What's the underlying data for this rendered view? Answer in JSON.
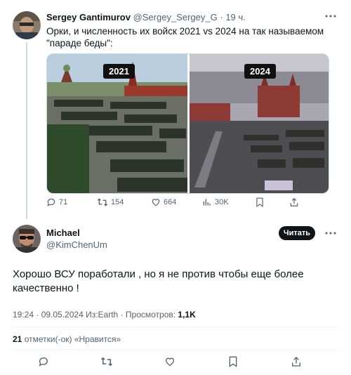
{
  "parent_tweet": {
    "author_name": "Sergey Gantimurov",
    "handle": "@Sergey_Sergey_G",
    "separator": "·",
    "time": "19 ч.",
    "text": "Орки, и численность их войск 2021 vs 2024 на так называемом \"параде беды\":",
    "media": {
      "left_label": "2021",
      "right_label": "2024"
    },
    "actions": {
      "replies": "71",
      "reposts": "154",
      "likes": "664",
      "views": "30K"
    }
  },
  "reply_tweet": {
    "author_name": "Michael",
    "handle": "@KimChenUm",
    "follow_label": "Читать",
    "text": "Хорошо ВСУ поработали , но я не против чтобы еще более качественно !",
    "meta_prefix": "19:24 · 09.05.2024 Из:Earth · Просмотров: ",
    "views": "1,1K",
    "likes_count": "21",
    "likes_suffix": " отметки(-ок) «Нравится»"
  },
  "icons": {
    "reply": "reply-icon",
    "repost": "repost-icon",
    "like": "heart-icon",
    "views": "views-chart-icon",
    "bookmark": "bookmark-icon",
    "share": "share-icon",
    "more": "more-dots-icon"
  },
  "colors": {
    "text": "#0f1419",
    "secondary": "#536471",
    "border": "#cfd9de",
    "button": "#0f1419"
  }
}
